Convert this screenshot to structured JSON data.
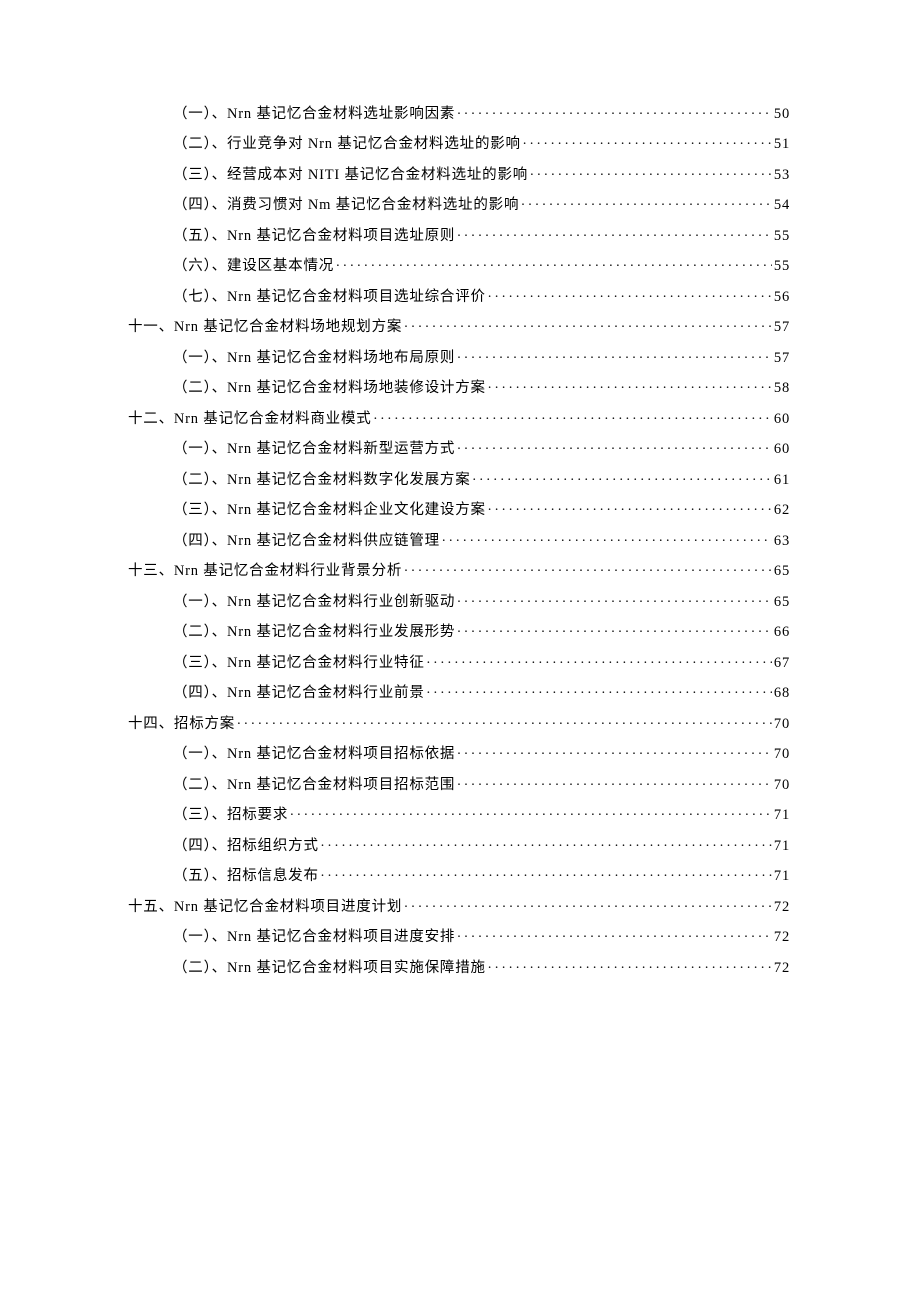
{
  "toc": [
    {
      "level": 2,
      "label": "（一）、Nrn 基记忆合金材料选址影响因素",
      "page": "50"
    },
    {
      "level": 2,
      "label": "（二）、行业竞争对 Nrn 基记忆合金材料选址的影响",
      "page": "51"
    },
    {
      "level": 2,
      "label": "（三）、经营成本对 NITI 基记忆合金材料选址的影响",
      "page": "53"
    },
    {
      "level": 2,
      "label": "（四）、消费习惯对 Nm 基记忆合金材料选址的影响",
      "page": "54"
    },
    {
      "level": 2,
      "label": "（五）、Nrn 基记忆合金材料项目选址原则",
      "page": "55"
    },
    {
      "level": 2,
      "label": "（六）、建设区基本情况",
      "page": "55"
    },
    {
      "level": 2,
      "label": "（七）、Nrn 基记忆合金材料项目选址综合评价",
      "page": "56"
    },
    {
      "level": 1,
      "label": "十一、Nrn 基记忆合金材料场地规划方案",
      "page": "57"
    },
    {
      "level": 2,
      "label": "（一）、Nrn 基记忆合金材料场地布局原则",
      "page": "57"
    },
    {
      "level": 2,
      "label": "（二）、Nrn 基记忆合金材料场地装修设计方案",
      "page": "58"
    },
    {
      "level": 1,
      "label": "十二、Nrn 基记忆合金材料商业模式",
      "page": "60"
    },
    {
      "level": 2,
      "label": "（一）、Nrn 基记忆合金材料新型运营方式",
      "page": "60"
    },
    {
      "level": 2,
      "label": "（二）、Nrn 基记忆合金材料数字化发展方案",
      "page": "61"
    },
    {
      "level": 2,
      "label": "（三）、Nrn 基记忆合金材料企业文化建设方案",
      "page": "62"
    },
    {
      "level": 2,
      "label": "（四）、Nrn 基记忆合金材料供应链管理",
      "page": "63"
    },
    {
      "level": 1,
      "label": "十三、Nrn 基记忆合金材料行业背景分析",
      "page": "65"
    },
    {
      "level": 2,
      "label": "（一）、Nrn 基记忆合金材料行业创新驱动",
      "page": "65"
    },
    {
      "level": 2,
      "label": "（二）、Nrn 基记忆合金材料行业发展形势",
      "page": "66"
    },
    {
      "level": 2,
      "label": "（三）、Nrn 基记忆合金材料行业特征",
      "page": "67"
    },
    {
      "level": 2,
      "label": "（四）、Nrn 基记忆合金材料行业前景",
      "page": "68"
    },
    {
      "level": 1,
      "label": "十四、招标方案",
      "page": "70"
    },
    {
      "level": 2,
      "label": "（一）、Nrn 基记忆合金材料项目招标依据",
      "page": "70"
    },
    {
      "level": 2,
      "label": "（二）、Nrn 基记忆合金材料项目招标范围",
      "page": "70"
    },
    {
      "level": 2,
      "label": "（三）、招标要求",
      "page": "71"
    },
    {
      "level": 2,
      "label": "（四）、招标组织方式",
      "page": "71"
    },
    {
      "level": 2,
      "label": "（五）、招标信息发布",
      "page": "71"
    },
    {
      "level": 1,
      "label": "十五、Nrn 基记忆合金材料项目进度计划",
      "page": "72"
    },
    {
      "level": 2,
      "label": "（一）、Nrn 基记忆合金材料项目进度安排",
      "page": "72"
    },
    {
      "level": 2,
      "label": "（二）、Nrn 基记忆合金材料项目实施保障措施",
      "page": "72"
    }
  ]
}
